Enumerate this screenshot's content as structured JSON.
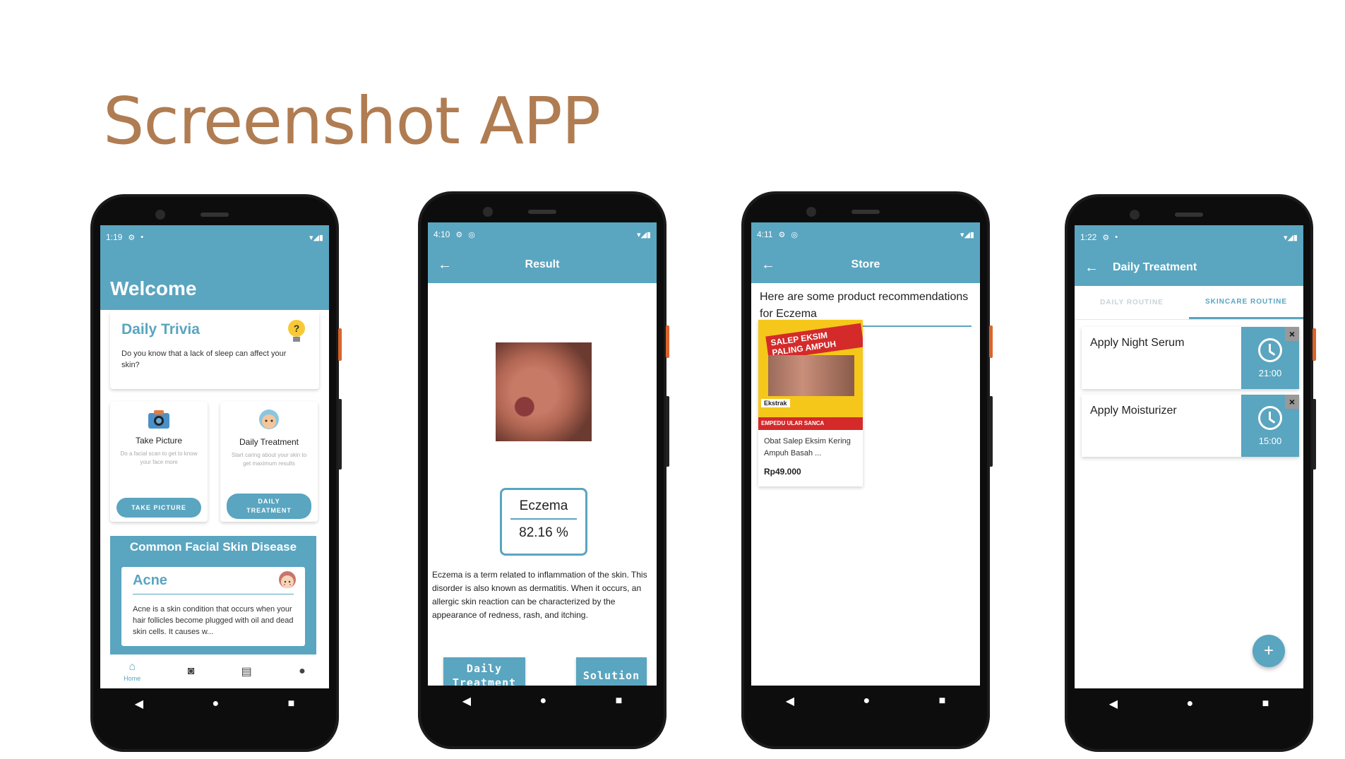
{
  "page_title": "Screenshot APP",
  "phones": [
    {
      "status_time": "1:19",
      "welcome": "Welcome",
      "trivia": {
        "title": "Daily Trivia",
        "text": "Do you know that a lack of sleep can affect your skin?"
      },
      "features": [
        {
          "title": "Take Picture",
          "sub": "Do a facial scan to get to know your face more",
          "button": "TAKE PICTURE"
        },
        {
          "title": "Daily Treatment",
          "sub": "Start caring about your skin to get maximum results",
          "button": "DAILY TREATMENT"
        }
      ],
      "disease_header": "Common Facial Skin Disease",
      "disease": {
        "title": "Acne",
        "text": "Acne is a skin condition that occurs when your hair follicles become plugged with oil and dead skin cells. It causes w..."
      },
      "bottom_nav": [
        {
          "icon": "home-icon",
          "label": "Home"
        },
        {
          "icon": "camera-icon",
          "label": ""
        },
        {
          "icon": "store-icon",
          "label": ""
        },
        {
          "icon": "person-icon",
          "label": ""
        }
      ]
    },
    {
      "status_time": "4:10",
      "appbar_title": "Result",
      "result_name": "Eczema",
      "result_percent": "82.16 %",
      "description": "Eczema is a term related to inflammation of the skin. This disorder is also known as dermatitis. When it occurs, an allergic skin reaction can be characterized by the appearance of redness, rash, and itching.",
      "btn_daily": "Daily Treatment",
      "btn_solution": "Solution"
    },
    {
      "status_time": "4:11",
      "appbar_title": "Store",
      "heading": "Here are some product recommendations for Eczema",
      "product": {
        "banner": "SALEP EKSIM PALING AMPUH",
        "strip": "EMPEDU ULAR SANCA",
        "tag": "Ekstrak",
        "name": "Obat Salep Eksim Kering Ampuh Basah ...",
        "price": "Rp49.000"
      }
    },
    {
      "status_time": "1:22",
      "appbar_title": "Daily Treatment",
      "tabs": [
        "DAILY ROUTINE",
        "SKINCARE ROUTINE"
      ],
      "routines": [
        {
          "name": "Apply Night Serum",
          "time": "21:00"
        },
        {
          "name": "Apply Moisturizer",
          "time": "15:00"
        }
      ],
      "fab": "+"
    }
  ],
  "colors": {
    "accent": "#5aa5c0",
    "title": "#b07c52"
  }
}
